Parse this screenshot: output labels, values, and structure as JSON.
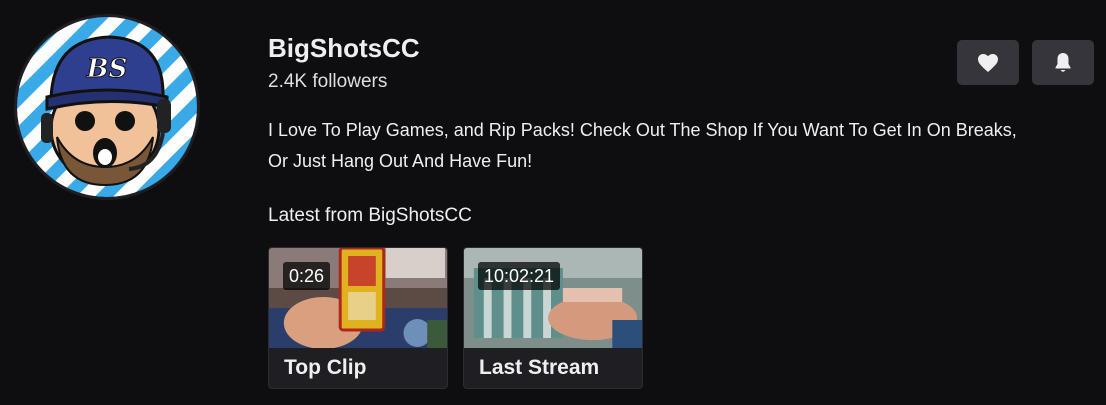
{
  "channel": {
    "name": "BigShotsCC",
    "followers": "2.4K followers",
    "bio": "I Love To Play Games, and Rip Packs! Check Out The Shop If You Want To Get In On Breaks, Or Just Hang Out And Have Fun!",
    "avatar_icon": "cartoon-avatar-icon",
    "avatar_monogram": "BS"
  },
  "actions": {
    "follow_icon": "heart-icon",
    "notify_icon": "bell-icon"
  },
  "latest": {
    "heading": "Latest from BigShotsCC",
    "cards": [
      {
        "duration": "0:26",
        "label": "Top Clip"
      },
      {
        "duration": "10:02:21",
        "label": "Last Stream"
      }
    ]
  },
  "colors": {
    "background": "#0e0e10",
    "button": "#35353b",
    "card": "#1f1f23",
    "text": "#efeff1",
    "avatar_stripe": "#3aa9e8"
  }
}
